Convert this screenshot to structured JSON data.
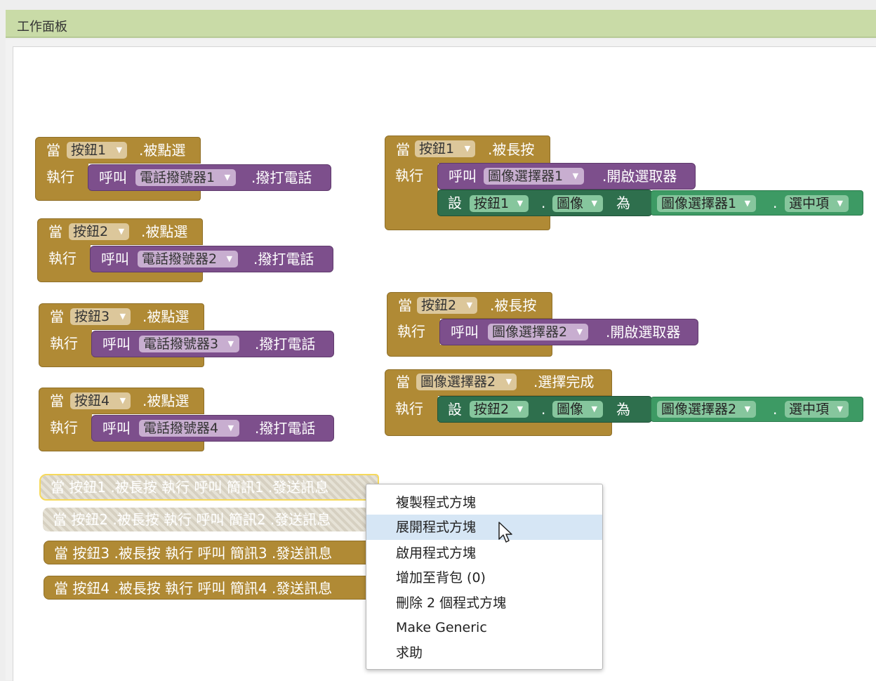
{
  "title": "工作面板",
  "common": {
    "when": "當",
    "do": "執行",
    "call": "呼叫",
    "set": "設",
    "to": "為",
    "dot": "."
  },
  "left_events": [
    {
      "component": "按鈕1",
      "event": ".被點選",
      "target": "電話撥號器1",
      "method": ".撥打電話"
    },
    {
      "component": "按鈕2",
      "event": ".被點選",
      "target": "電話撥號器2",
      "method": ".撥打電話"
    },
    {
      "component": "按鈕3",
      "event": ".被點選",
      "target": "電話撥號器3",
      "method": ".撥打電話"
    },
    {
      "component": "按鈕4",
      "event": ".被點選",
      "target": "電話撥號器4",
      "method": ".撥打電話"
    }
  ],
  "right_event_1": {
    "component": "按鈕1",
    "event": ".被長按",
    "target": "圖像選擇器1",
    "method": ".開啟選取器",
    "set_component": "按鈕1",
    "set_property": "圖像",
    "get_component": "圖像選擇器1",
    "get_property": "選中項"
  },
  "right_event_2": {
    "component": "按鈕2",
    "event": ".被長按",
    "target": "圖像選擇器2",
    "method": ".開啟選取器"
  },
  "right_event_3": {
    "component": "圖像選擇器2",
    "event": ".選擇完成",
    "set_component": "按鈕2",
    "set_property": "圖像",
    "get_component": "圖像選擇器2",
    "get_property": "選中項"
  },
  "collapsed": [
    {
      "text": "當 按鈕1 .被長按 執行 呼叫 簡訊1 .發送訊息",
      "state": "disabled-selected"
    },
    {
      "text": "當 按鈕2 .被長按 執行 呼叫 簡訊2 .發送訊息",
      "state": "disabled"
    },
    {
      "text": "當 按鈕3 .被長按 執行 呼叫 簡訊3 .發送訊息",
      "state": "enabled"
    },
    {
      "text": "當 按鈕4 .被長按 執行 呼叫 簡訊4 .發送訊息",
      "state": "enabled"
    }
  ],
  "context_menu": {
    "items": [
      "複製程式方塊",
      "展開程式方塊",
      "啟用程式方塊",
      "增加至背包 (0)",
      "刪除 2 個程式方塊",
      "Make Generic",
      "求助"
    ],
    "highlighted": "展開程式方塊"
  },
  "icons": {
    "dropdown": "▼"
  },
  "colors": {
    "event": "#b08a35",
    "procedure": "#7d4f8c",
    "setter": "#2e6f4d",
    "getter": "#3d9a64",
    "titlebar": "#c9dba7",
    "menu_highlight": "#d6e6f5"
  }
}
